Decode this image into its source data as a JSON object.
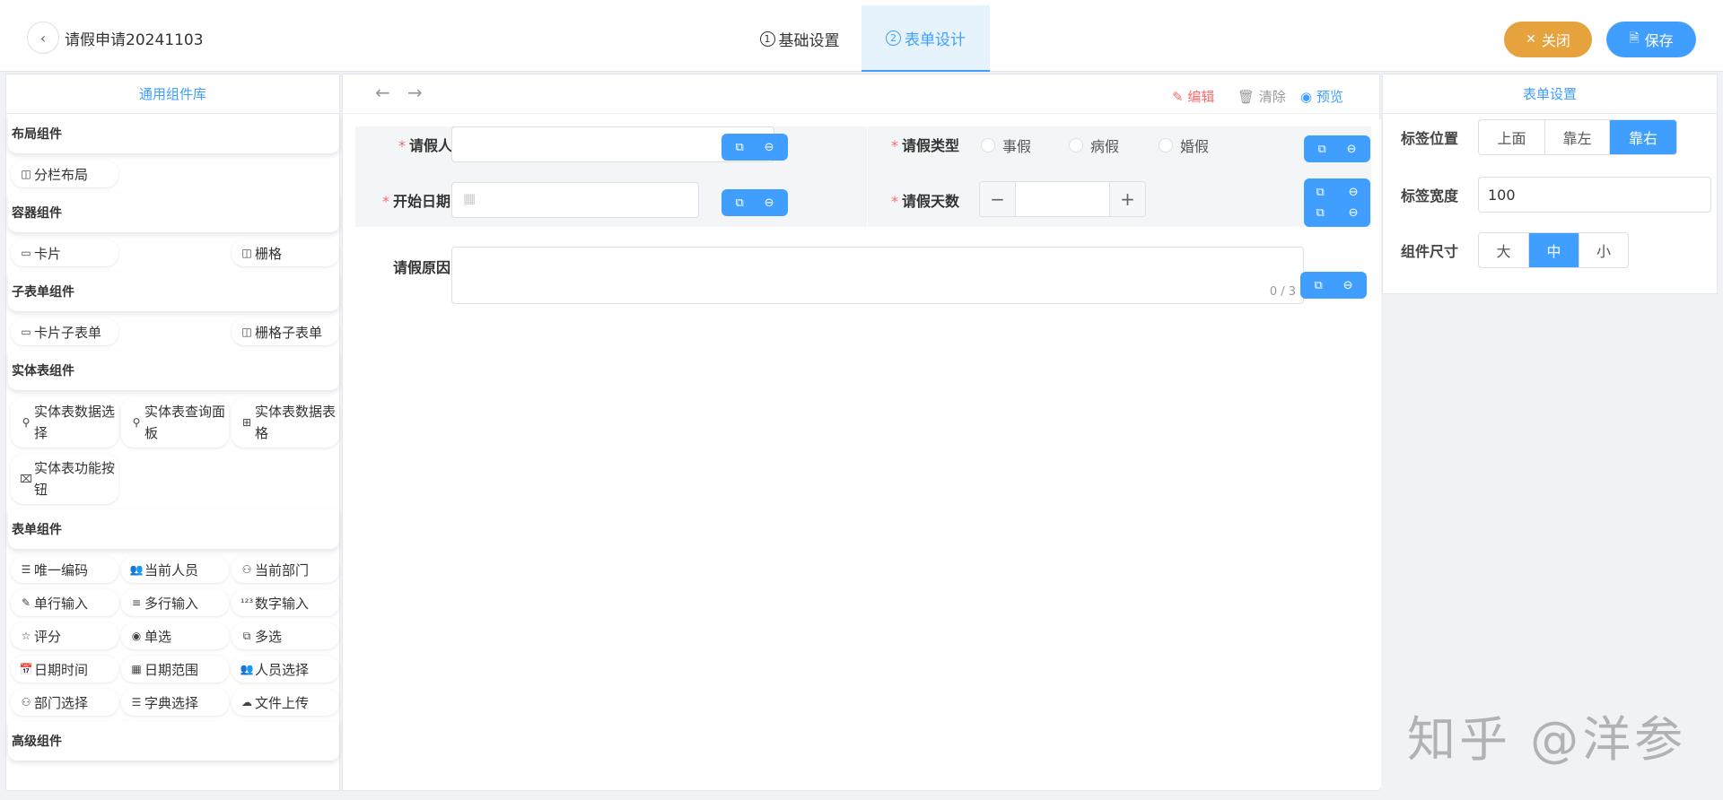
{
  "header": {
    "title": "请假申请20241103",
    "steps": [
      {
        "num": "1",
        "label": "基础设置"
      },
      {
        "num": "2",
        "label": "表单设计"
      }
    ],
    "close_label": "关闭",
    "save_label": "保存"
  },
  "library": {
    "title": "通用组件库",
    "groups": {
      "layout": {
        "title": "布局组件",
        "items": [
          "分栏布局"
        ]
      },
      "container": {
        "title": "容器组件",
        "items": [
          "卡片",
          "栅格"
        ]
      },
      "subform": {
        "title": "子表单组件",
        "items": [
          "卡片子表单",
          "栅格子表单"
        ]
      },
      "entity": {
        "title": "实体表组件",
        "items": [
          "实体表数据选择",
          "实体表查询面板",
          "实体表数据表格",
          "实体表功能按钮"
        ]
      },
      "form": {
        "title": "表单组件",
        "items": [
          "唯一编码",
          "当前人员",
          "当前部门",
          "单行输入",
          "多行输入",
          "数字输入",
          "评分",
          "单选",
          "多选",
          "日期时间",
          "日期范围",
          "人员选择",
          "部门选择",
          "字典选择",
          "文件上传"
        ]
      },
      "advanced": {
        "title": "高级组件"
      }
    }
  },
  "toolbar": {
    "edit": "编辑",
    "clear": "清除",
    "preview": "预览"
  },
  "form": {
    "applicant_label": "请假人",
    "leave_type_label": "请假类型",
    "leave_type_options": [
      "事假",
      "病假",
      "婚假"
    ],
    "start_date_label": "开始日期",
    "days_label": "请假天数",
    "reason_label": "请假原因",
    "reason_counter": "0 / 3"
  },
  "settings": {
    "title": "表单设置",
    "label_position": {
      "label": "标签位置",
      "options": [
        "上面",
        "靠左",
        "靠右"
      ],
      "selected": "靠右"
    },
    "label_width": {
      "label": "标签宽度",
      "value": "100"
    },
    "size": {
      "label": "组件尺寸",
      "options": [
        "大",
        "中",
        "小"
      ],
      "selected": "中"
    }
  },
  "colors": {
    "primary": "#409eff",
    "warning": "#e6a23c",
    "danger": "#f56c6c"
  }
}
